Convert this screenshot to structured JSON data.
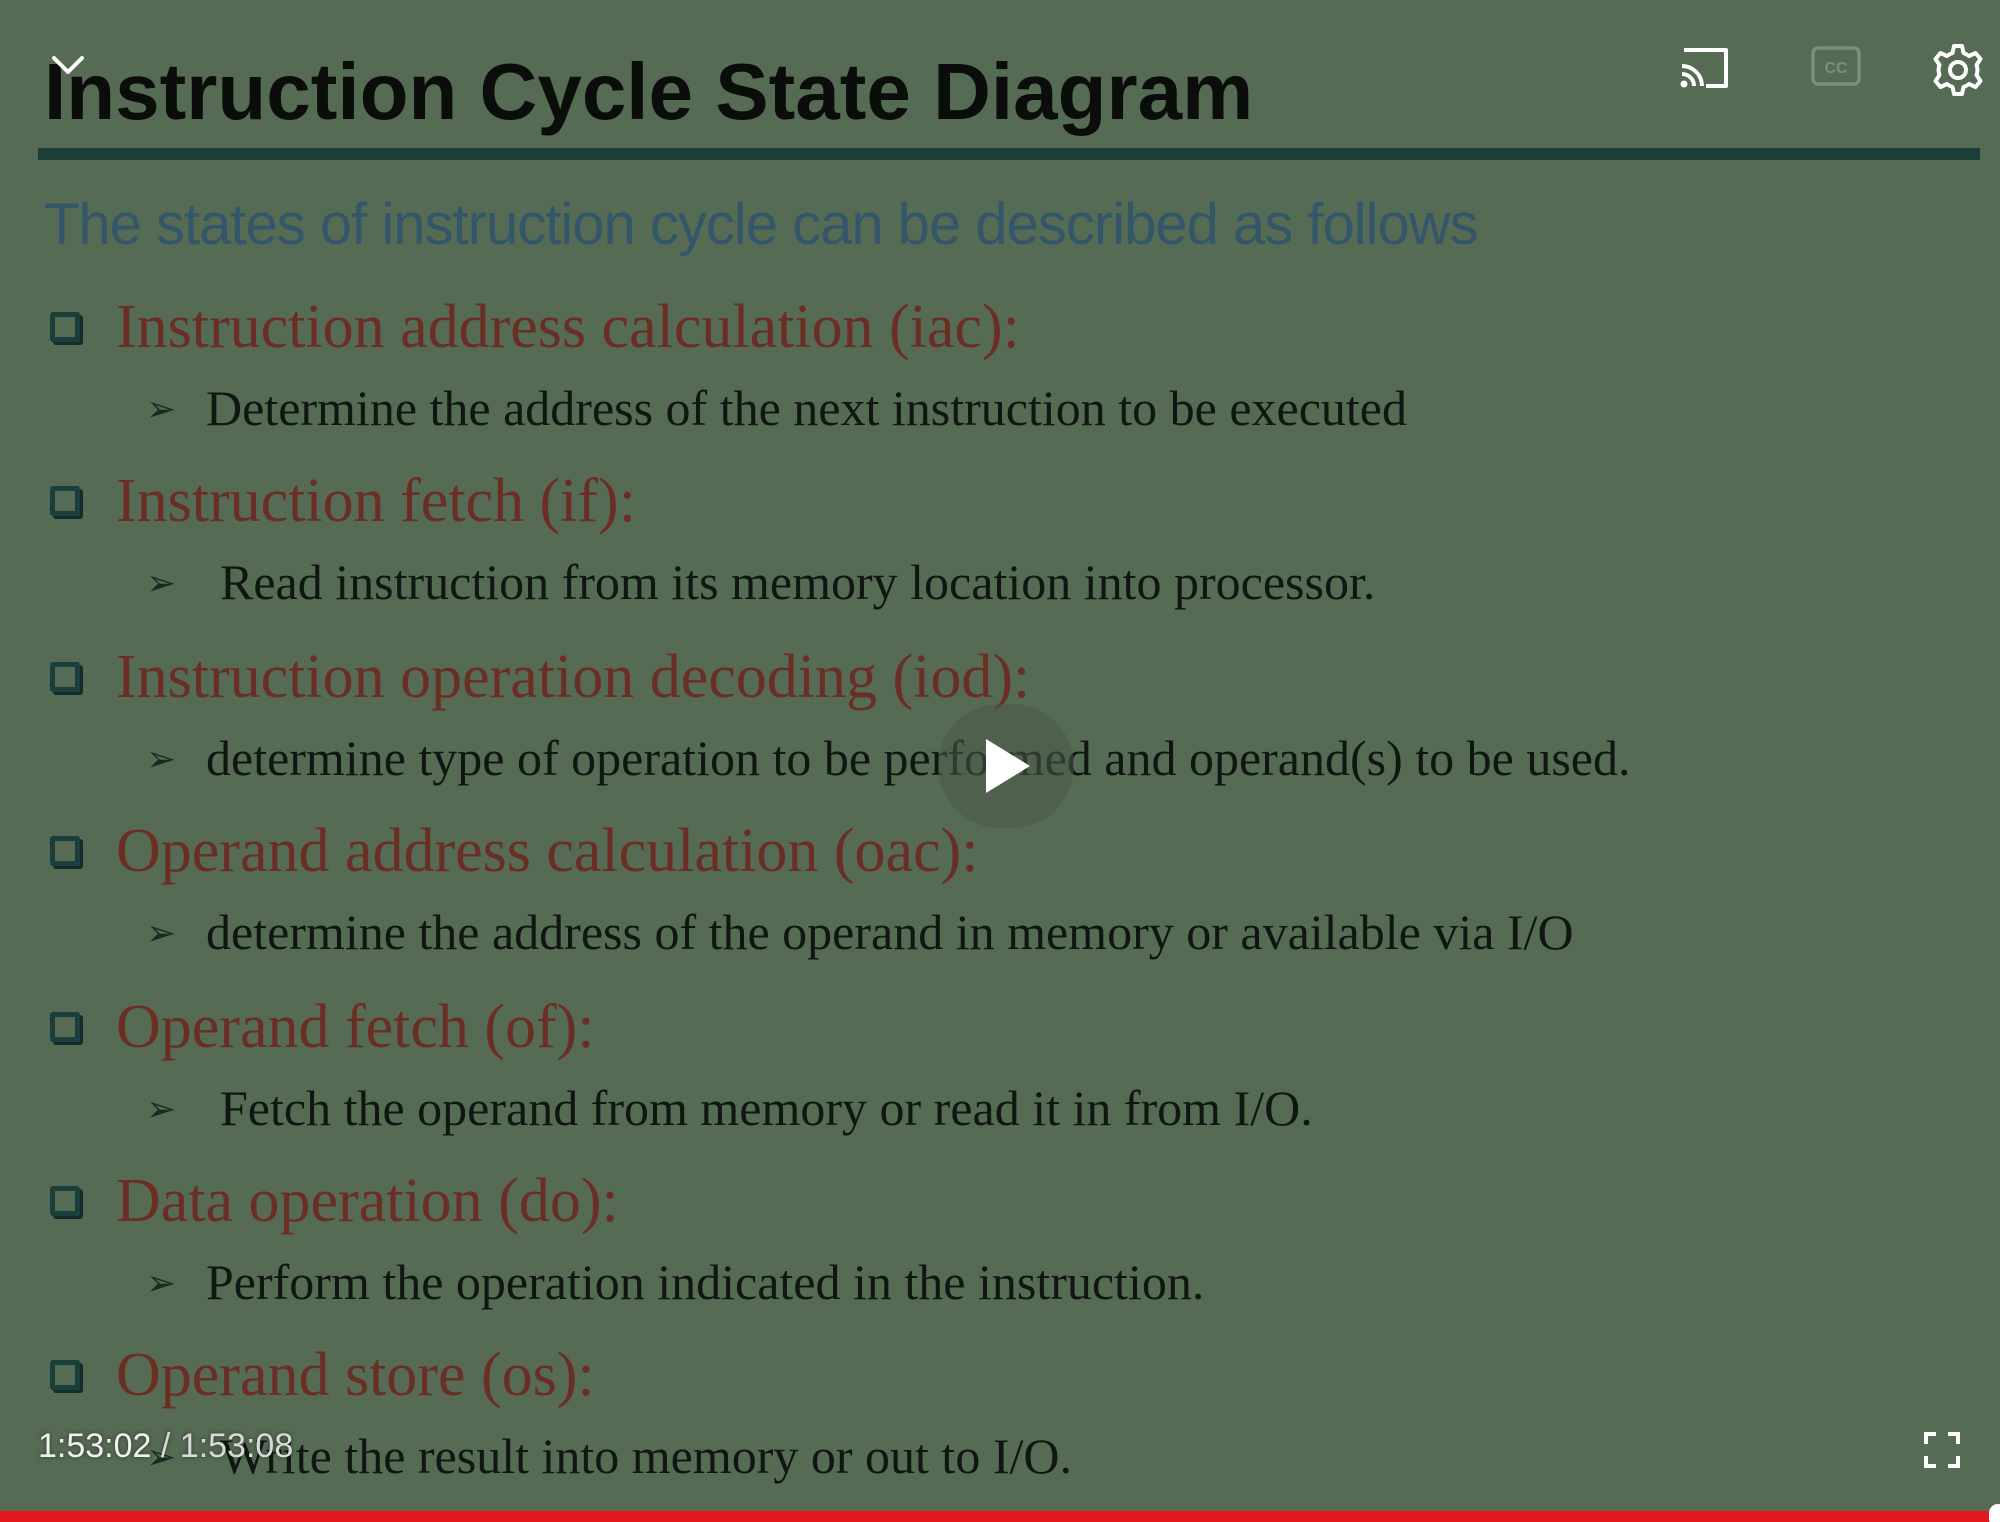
{
  "slide": {
    "title": "Instruction Cycle State Diagram",
    "subtitle": "The states of instruction cycle can be described as follows",
    "items": [
      {
        "heading": "Instruction address calculation (iac):",
        "detail": "Determine the address of the next instruction to be executed"
      },
      {
        "heading": "Instruction fetch (if):",
        "detail": "Read instruction from its memory location into processor."
      },
      {
        "heading": "Instruction operation decoding (iod):",
        "detail": "determine type of operation to be performed and operand(s) to be used."
      },
      {
        "heading": "Operand address calculation (oac):",
        "detail": "determine the address of the operand in memory or available via I/O"
      },
      {
        "heading": "Operand fetch (of):",
        "detail": "Fetch the operand from memory or read it in from I/O."
      },
      {
        "heading": "Data operation (do):",
        "detail": "Perform the operation indicated in the instruction."
      },
      {
        "heading": "Operand store (os):",
        "detail": "Write the result into memory or out to I/O."
      }
    ]
  },
  "player": {
    "current_time": "1:53:02",
    "separator": " / ",
    "duration": "1:53:08",
    "progress": 0.9991,
    "icons": [
      "chevron-down-icon",
      "cast-icon",
      "closed-captions-icon",
      "settings-gear-icon",
      "play-icon",
      "fullscreen-icon"
    ],
    "colors": {
      "progress": "#e4171d",
      "heading": "#6b2e25",
      "subtitle": "#34566a",
      "background": "#566b53"
    }
  }
}
